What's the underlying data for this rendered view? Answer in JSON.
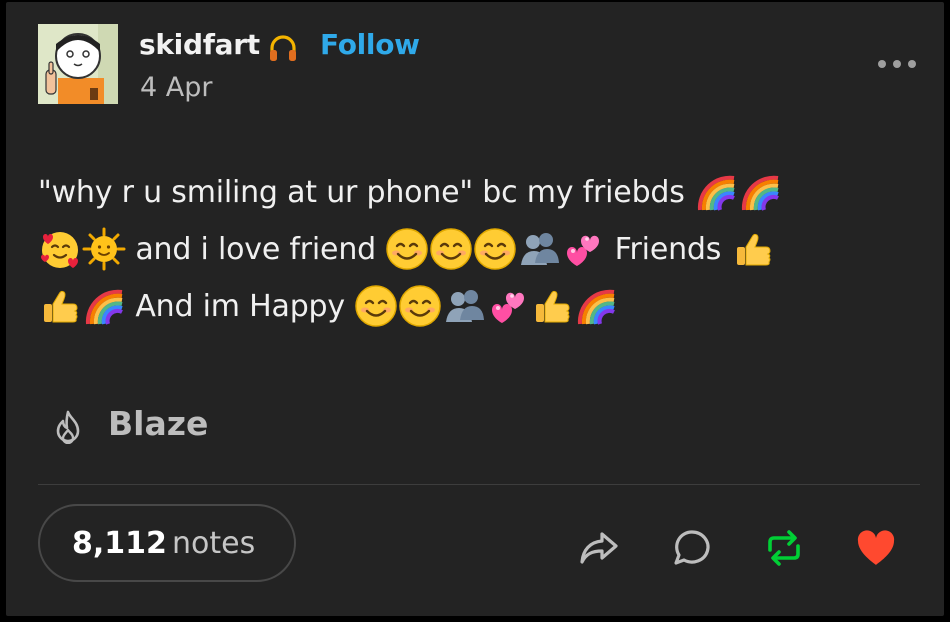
{
  "post": {
    "blog_name": "skidfart",
    "follow_label": "Follow",
    "date": "4 Apr",
    "body": {
      "line1_text": "\"why r u smiling at ur phone\" bc my friebds",
      "line2_text_a": "and i love friend",
      "line2_text_b": "Friends",
      "line3_text": "And im Happy"
    },
    "blaze_label": "Blaze"
  },
  "footer": {
    "notes_count": "8,112",
    "notes_label": "notes"
  },
  "icons": {
    "headphones": "headphones-icon",
    "more": "more-options-icon",
    "blaze": "flame-icon",
    "share": "share-arrow-icon",
    "reply": "speech-bubble-icon",
    "reblog": "reblog-icon",
    "like": "heart-icon"
  },
  "colors": {
    "background": "#232323",
    "follow": "#2fa9e9",
    "reblog": "#00cf35",
    "like": "#ff492f"
  }
}
